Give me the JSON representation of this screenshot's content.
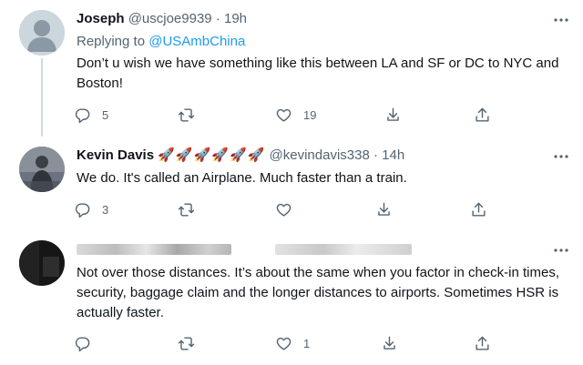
{
  "tweets": [
    {
      "name": "Joseph",
      "handle": "@uscjoe9939",
      "separator": "·",
      "time": "19h",
      "replying_prefix": "Replying to ",
      "replying_to": "@USAmbChina",
      "text": "Don’t u wish we have something like this between LA and SF or DC to NYC and Boston!",
      "reply_count": "5",
      "retweet_count": "",
      "like_count": "19"
    },
    {
      "name": "Kevin Davis",
      "name_emojis": [
        "🚀",
        "🚀",
        "🚀",
        "🚀",
        "🚀",
        "🚀"
      ],
      "handle": "@kevindavis338",
      "separator": "·",
      "time": "14h",
      "text": "We do. It's called an Airplane. Much faster than a train.",
      "reply_count": "3",
      "retweet_count": "",
      "like_count": ""
    },
    {
      "name_redacted": true,
      "text": "Not over those distances. It’s about the same when you factor in check-in times, security, baggage claim and the longer distances to airports. Sometimes HSR is actually faster.",
      "reply_count": "",
      "retweet_count": "",
      "like_count": "1"
    }
  ],
  "icons": {
    "reply": "reply-icon",
    "retweet": "retweet-icon",
    "like": "heart-icon",
    "dm": "dm-icon",
    "share": "share-icon",
    "more": "more-icon"
  },
  "colors": {
    "text": "#0f1419",
    "muted": "#536471",
    "link": "#1d9bf0",
    "thread_line": "#cfd9de"
  }
}
